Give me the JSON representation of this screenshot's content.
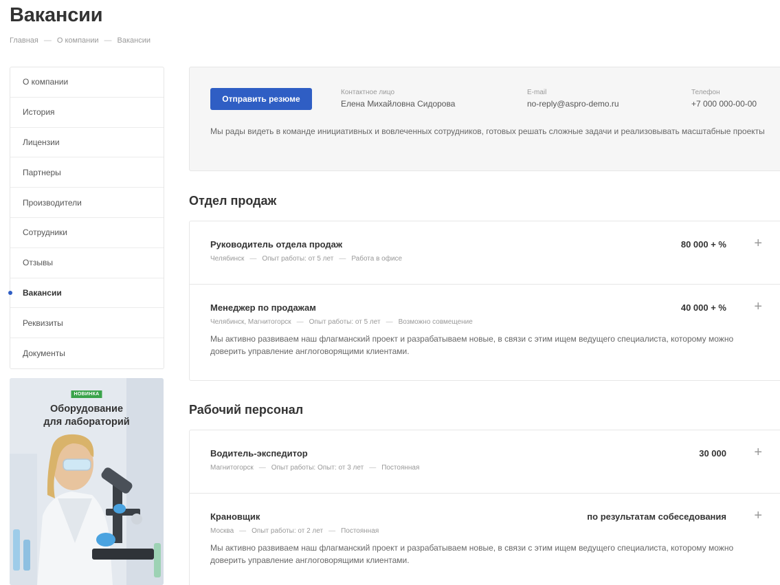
{
  "page": {
    "title": "Вакансии"
  },
  "breadcrumb": {
    "items": [
      "Главная",
      "О компании",
      "Вакансии"
    ],
    "separator": "—"
  },
  "sidebar": {
    "items": [
      {
        "label": "О компании"
      },
      {
        "label": "История"
      },
      {
        "label": "Лицензии"
      },
      {
        "label": "Партнеры"
      },
      {
        "label": "Производители"
      },
      {
        "label": "Сотрудники"
      },
      {
        "label": "Отзывы"
      },
      {
        "label": "Вакансии",
        "active": true
      },
      {
        "label": "Реквизиты"
      },
      {
        "label": "Документы"
      }
    ]
  },
  "promo": {
    "badge": "НОВИНКА",
    "title_line1": "Оборудование",
    "title_line2": "для лабораторий"
  },
  "contact": {
    "button_label": "Отправить резюме",
    "person_label": "Контактное лицо",
    "person_value": "Елена Михайловна Сидорова",
    "email_label": "E-mail",
    "email_value": "no-reply@aspro-demo.ru",
    "phone_label": "Телефон",
    "phone_value": "+7 000 000-00-00",
    "description": "Мы рады видеть в команде инициативных и вовлеченных сотрудников, готовых решать сложные задачи и реализовывать масштабные проекты"
  },
  "sections": [
    {
      "title": "Отдел продаж",
      "vacancies": [
        {
          "title": "Руководитель отдела продаж",
          "salary": "80 000 + %",
          "meta": [
            "Челябинск",
            "Опыт работы: от 5 лет",
            "Работа в офисе"
          ],
          "description": ""
        },
        {
          "title": "Менеджер по продажам",
          "salary": "40 000 + %",
          "meta": [
            "Челябинск, Магнитогорск",
            "Опыт работы: от 5 лет",
            "Возможно совмещение"
          ],
          "description": "Мы активно развиваем наш флагманский проект и разрабатываем новые, в связи с этим ищем ведущего специалиста, которому можно доверить управление англоговорящими клиентами."
        }
      ]
    },
    {
      "title": "Рабочий персонал",
      "vacancies": [
        {
          "title": "Водитель-экспедитор",
          "salary": "30 000",
          "meta": [
            "Магнитогорск",
            "Опыт работы: Опыт: от 3 лет",
            "Постоянная"
          ],
          "description": ""
        },
        {
          "title": "Крановщик",
          "salary": "по результатам собеседования",
          "meta": [
            "Москва",
            "Опыт работы: от 2 лет",
            "Постоянная"
          ],
          "description": "Мы активно развиваем наш флагманский проект и разрабатываем новые, в связи с этим ищем ведущего специалиста, которому можно доверить управление англоговорящими клиентами."
        }
      ]
    }
  ],
  "icons": {
    "expand": "plus-icon"
  },
  "colors": {
    "accent": "#2f5ec4",
    "badge": "#3aa34a"
  }
}
